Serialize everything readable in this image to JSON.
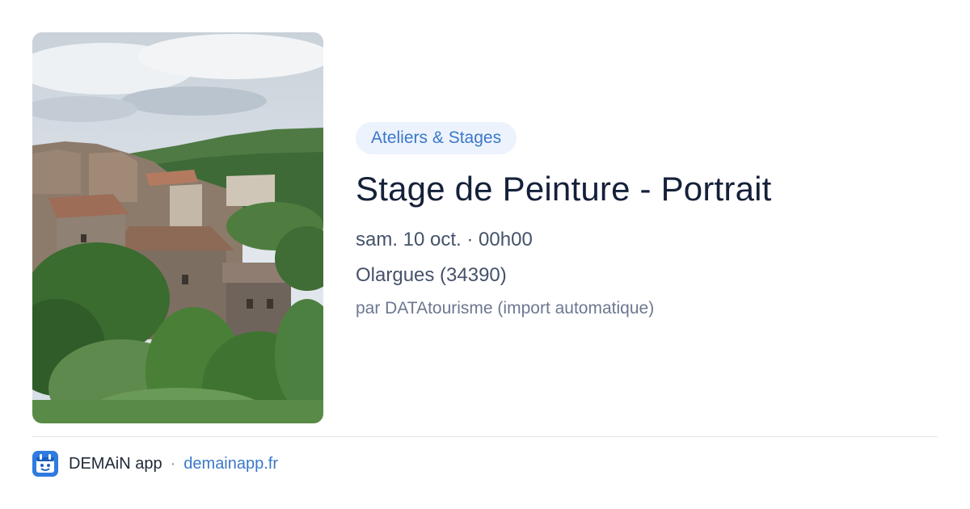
{
  "event": {
    "category_tag": "Ateliers & Stages",
    "title": "Stage de Peinture - Portrait",
    "datetime": "sam. 10 oct. · 00h00",
    "location": "Olargues (34390)",
    "author": "par DATAtourisme (import automatique)",
    "image": {
      "subject": "photo of a hillside stone village with green trees and a cloudy sky"
    }
  },
  "footer": {
    "app_name": "DEMAiN app",
    "separator": "·",
    "app_url": "demainapp.fr",
    "app_icon": "demain-app-icon"
  },
  "colors": {
    "accent": "#3a78c9",
    "tag_bg": "#edf3fc",
    "title": "#15203a",
    "body_text": "#45526a",
    "muted_text": "#6c7890"
  }
}
